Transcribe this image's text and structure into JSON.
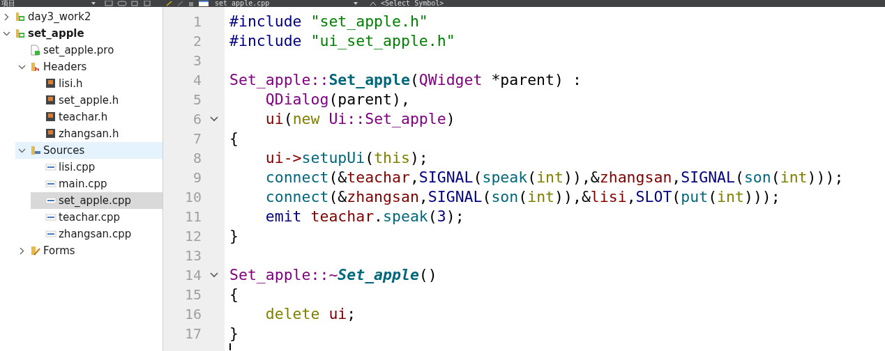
{
  "toolbar": {
    "panel_title": "项目",
    "file_name": "set_apple.cpp",
    "symbol": "<Select Symbol>"
  },
  "project_tree": [
    {
      "label": "day3_work2",
      "kind": "project",
      "expanded": false,
      "active": false,
      "selected": false,
      "hovered": false
    },
    {
      "label": "set_apple",
      "kind": "project",
      "expanded": true,
      "active": true,
      "selected": false,
      "hovered": false,
      "children": [
        {
          "label": "set_apple.pro",
          "kind": "pro",
          "selected": false,
          "hovered": false
        },
        {
          "label": "Headers",
          "kind": "folder-h",
          "expanded": true,
          "selected": false,
          "hovered": false,
          "children": [
            {
              "label": "lisi.h",
              "kind": "header",
              "selected": false,
              "hovered": false
            },
            {
              "label": "set_apple.h",
              "kind": "header",
              "selected": false,
              "hovered": false
            },
            {
              "label": "teachar.h",
              "kind": "header",
              "selected": false,
              "hovered": false
            },
            {
              "label": "zhangsan.h",
              "kind": "header",
              "selected": false,
              "hovered": false
            }
          ]
        },
        {
          "label": "Sources",
          "kind": "folder-cpp",
          "expanded": true,
          "selected": false,
          "hovered": true,
          "children": [
            {
              "label": "lisi.cpp",
              "kind": "source",
              "selected": false,
              "hovered": false
            },
            {
              "label": "main.cpp",
              "kind": "source",
              "selected": false,
              "hovered": false
            },
            {
              "label": "set_apple.cpp",
              "kind": "source",
              "selected": true,
              "hovered": false
            },
            {
              "label": "teachar.cpp",
              "kind": "source",
              "selected": false,
              "hovered": false
            },
            {
              "label": "zhangsan.cpp",
              "kind": "source",
              "selected": false,
              "hovered": false
            }
          ]
        },
        {
          "label": "Forms",
          "kind": "folder-forms",
          "expanded": false,
          "selected": false,
          "hovered": false
        }
      ]
    }
  ],
  "editor": {
    "lines": [
      {
        "number": "1",
        "fold": false,
        "tokens": [
          {
            "kind": "pp",
            "text": "#include "
          },
          {
            "kind": "str",
            "text": "\"set_apple.h\""
          }
        ]
      },
      {
        "number": "2",
        "fold": false,
        "tokens": [
          {
            "kind": "pp",
            "text": "#include "
          },
          {
            "kind": "str",
            "text": "\"ui_set_apple.h\""
          }
        ]
      },
      {
        "number": "3"
      },
      {
        "number": "4",
        "fold": false,
        "tokens": [
          {
            "kind": "type",
            "text": "Set_apple::"
          },
          {
            "kind": "decl",
            "text": "Set_apple"
          },
          {
            "kind": "plain",
            "text": "("
          },
          {
            "kind": "type",
            "text": "QWidget"
          },
          {
            "kind": "plain",
            "text": " *parent) :"
          }
        ]
      },
      {
        "number": "5",
        "fold": false,
        "tokens": [
          {
            "kind": "type",
            "text": "    QDialog"
          },
          {
            "kind": "plain",
            "text": "(parent),"
          }
        ]
      },
      {
        "number": "6",
        "fold": true,
        "tokens": [
          {
            "kind": "member",
            "text": "    ui"
          },
          {
            "kind": "plain",
            "text": "("
          },
          {
            "kind": "kw",
            "text": "new "
          },
          {
            "kind": "type",
            "text": "Ui::Set_apple"
          },
          {
            "kind": "plain",
            "text": ")"
          }
        ]
      },
      {
        "number": "7",
        "fold": false,
        "tokens": [
          {
            "kind": "plain",
            "text": "{"
          }
        ]
      },
      {
        "number": "8",
        "fold": false,
        "tokens": [
          {
            "kind": "member",
            "text": "    ui->"
          },
          {
            "kind": "call",
            "text": "setupUi"
          },
          {
            "kind": "plain",
            "text": "("
          },
          {
            "kind": "kw",
            "text": "this"
          },
          {
            "kind": "plain",
            "text": ");"
          }
        ]
      },
      {
        "number": "9",
        "fold": false,
        "tokens": [
          {
            "kind": "call",
            "text": "    connect"
          },
          {
            "kind": "plain",
            "text": "(&"
          },
          {
            "kind": "member",
            "text": "teachar"
          },
          {
            "kind": "plain",
            "text": ","
          },
          {
            "kind": "macro",
            "text": "SIGNAL"
          },
          {
            "kind": "plain",
            "text": "("
          },
          {
            "kind": "call",
            "text": "speak"
          },
          {
            "kind": "plain",
            "text": "("
          },
          {
            "kind": "kw",
            "text": "int"
          },
          {
            "kind": "plain",
            "text": ")),&"
          },
          {
            "kind": "member",
            "text": "zhangsan"
          },
          {
            "kind": "plain",
            "text": ","
          },
          {
            "kind": "macro",
            "text": "SIGNAL"
          },
          {
            "kind": "plain",
            "text": "("
          },
          {
            "kind": "call",
            "text": "son"
          },
          {
            "kind": "plain",
            "text": "("
          },
          {
            "kind": "kw",
            "text": "int"
          },
          {
            "kind": "plain",
            "text": ")));"
          }
        ]
      },
      {
        "number": "10",
        "fold": false,
        "tokens": [
          {
            "kind": "call",
            "text": "    connect"
          },
          {
            "kind": "plain",
            "text": "(&"
          },
          {
            "kind": "member",
            "text": "zhangsan"
          },
          {
            "kind": "plain",
            "text": ","
          },
          {
            "kind": "macro",
            "text": "SIGNAL"
          },
          {
            "kind": "plain",
            "text": "("
          },
          {
            "kind": "call",
            "text": "son"
          },
          {
            "kind": "plain",
            "text": "("
          },
          {
            "kind": "kw",
            "text": "int"
          },
          {
            "kind": "plain",
            "text": ")),&"
          },
          {
            "kind": "member",
            "text": "lisi"
          },
          {
            "kind": "plain",
            "text": ","
          },
          {
            "kind": "macro",
            "text": "SLOT"
          },
          {
            "kind": "plain",
            "text": "("
          },
          {
            "kind": "call",
            "text": "put"
          },
          {
            "kind": "plain",
            "text": "("
          },
          {
            "kind": "kw",
            "text": "int"
          },
          {
            "kind": "plain",
            "text": ")));"
          }
        ]
      },
      {
        "number": "11",
        "fold": false,
        "tokens": [
          {
            "kind": "macro",
            "text": "    emit "
          },
          {
            "kind": "member",
            "text": "teachar"
          },
          {
            "kind": "plain",
            "text": "."
          },
          {
            "kind": "call",
            "text": "speak"
          },
          {
            "kind": "plain",
            "text": "("
          },
          {
            "kind": "macro",
            "text": "3"
          },
          {
            "kind": "plain",
            "text": ");"
          }
        ]
      },
      {
        "number": "12",
        "fold": false,
        "tokens": [
          {
            "kind": "plain",
            "text": "}"
          }
        ]
      },
      {
        "number": "13"
      },
      {
        "number": "14",
        "fold": true,
        "tokens": [
          {
            "kind": "type",
            "text": "Set_apple::~"
          },
          {
            "kind": "decl-italic",
            "text": "Set_apple"
          },
          {
            "kind": "plain",
            "text": "()"
          }
        ]
      },
      {
        "number": "15",
        "fold": false,
        "tokens": [
          {
            "kind": "plain",
            "text": "{"
          }
        ]
      },
      {
        "number": "16",
        "fold": false,
        "tokens": [
          {
            "kind": "kw",
            "text": "    delete "
          },
          {
            "kind": "member",
            "text": "ui"
          },
          {
            "kind": "plain",
            "text": ";"
          }
        ]
      },
      {
        "number": "17",
        "fold": false,
        "tokens": [
          {
            "kind": "plain",
            "text": "}"
          }
        ]
      },
      {
        "caret": true
      }
    ]
  }
}
